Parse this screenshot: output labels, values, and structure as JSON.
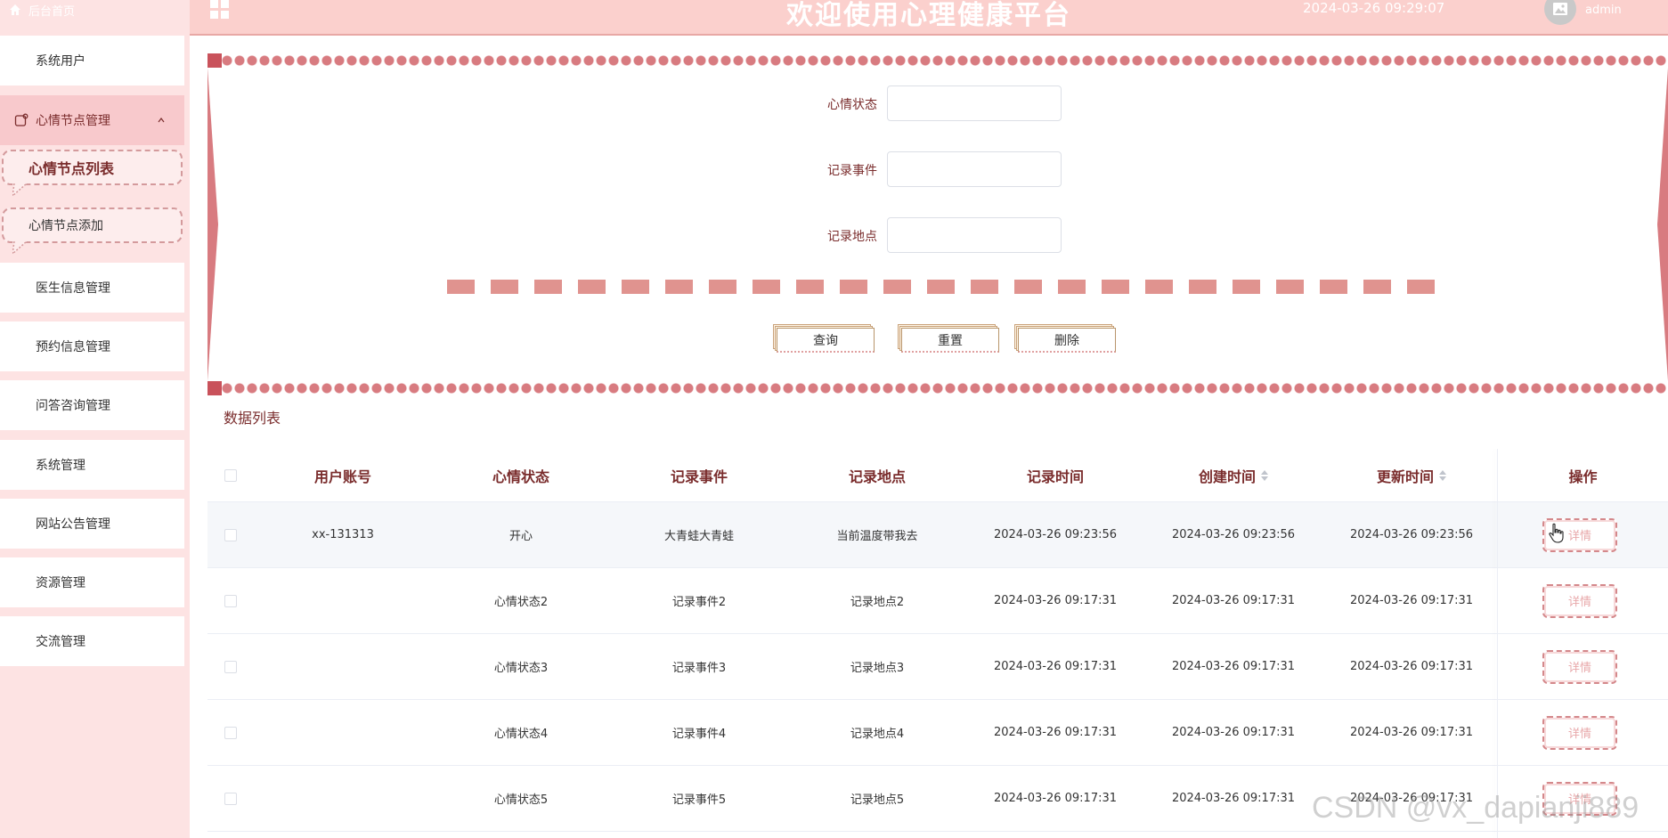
{
  "sidebar": {
    "home_label": "后台首页",
    "items": [
      {
        "label": "系统用户"
      },
      {
        "label": "心情节点管理"
      },
      {
        "label": "心情节点列表"
      },
      {
        "label": "心情节点添加"
      },
      {
        "label": "医生信息管理"
      },
      {
        "label": "预约信息管理"
      },
      {
        "label": "问答咨询管理"
      },
      {
        "label": "系统管理"
      },
      {
        "label": "网站公告管理"
      },
      {
        "label": "资源管理"
      },
      {
        "label": "交流管理"
      }
    ]
  },
  "header": {
    "title": "欢迎使用心理健康平台",
    "datetime": "2024-03-26 09:29:07",
    "user": "admin"
  },
  "search": {
    "fields": [
      {
        "label": "心情状态",
        "value": "",
        "placeholder": ""
      },
      {
        "label": "记录事件",
        "value": "",
        "placeholder": ""
      },
      {
        "label": "记录地点",
        "value": "",
        "placeholder": ""
      }
    ],
    "buttons": {
      "query": "查询",
      "reset": "重置",
      "delete": "删除"
    }
  },
  "list": {
    "title": "数据列表",
    "columns": [
      "用户账号",
      "心情状态",
      "记录事件",
      "记录地点",
      "记录时间",
      "创建时间",
      "更新时间",
      "操作"
    ],
    "rows": [
      [
        "xx-131313",
        "开心",
        "大青蛙大青蛙",
        "当前温度带我去",
        "2024-03-26 09:23:56",
        "2024-03-26 09:23:56",
        "2024-03-26 09:23:56",
        "详情"
      ],
      [
        "",
        "心情状态2",
        "记录事件2",
        "记录地点2",
        "2024-03-26 09:17:31",
        "2024-03-26 09:17:31",
        "2024-03-26 09:17:31",
        "详情"
      ],
      [
        "",
        "心情状态3",
        "记录事件3",
        "记录地点3",
        "2024-03-26 09:17:31",
        "2024-03-26 09:17:31",
        "2024-03-26 09:17:31",
        "详情"
      ],
      [
        "",
        "心情状态4",
        "记录事件4",
        "记录地点4",
        "2024-03-26 09:17:31",
        "2024-03-26 09:17:31",
        "2024-03-26 09:17:31",
        "详情"
      ],
      [
        "",
        "心情状态5",
        "记录事件5",
        "记录地点5",
        "2024-03-26 09:17:31",
        "2024-03-26 09:17:31",
        "2024-03-26 09:17:31",
        "详情"
      ]
    ]
  },
  "watermark": "CSDN @vx_dapianji889",
  "colors": {
    "accent": "#7a2c2c",
    "header_bg": "#fbd0cd",
    "sidebar_bg": "#fde3e3",
    "active_bg": "#f8c9cc",
    "scallop": "#d87b80"
  }
}
